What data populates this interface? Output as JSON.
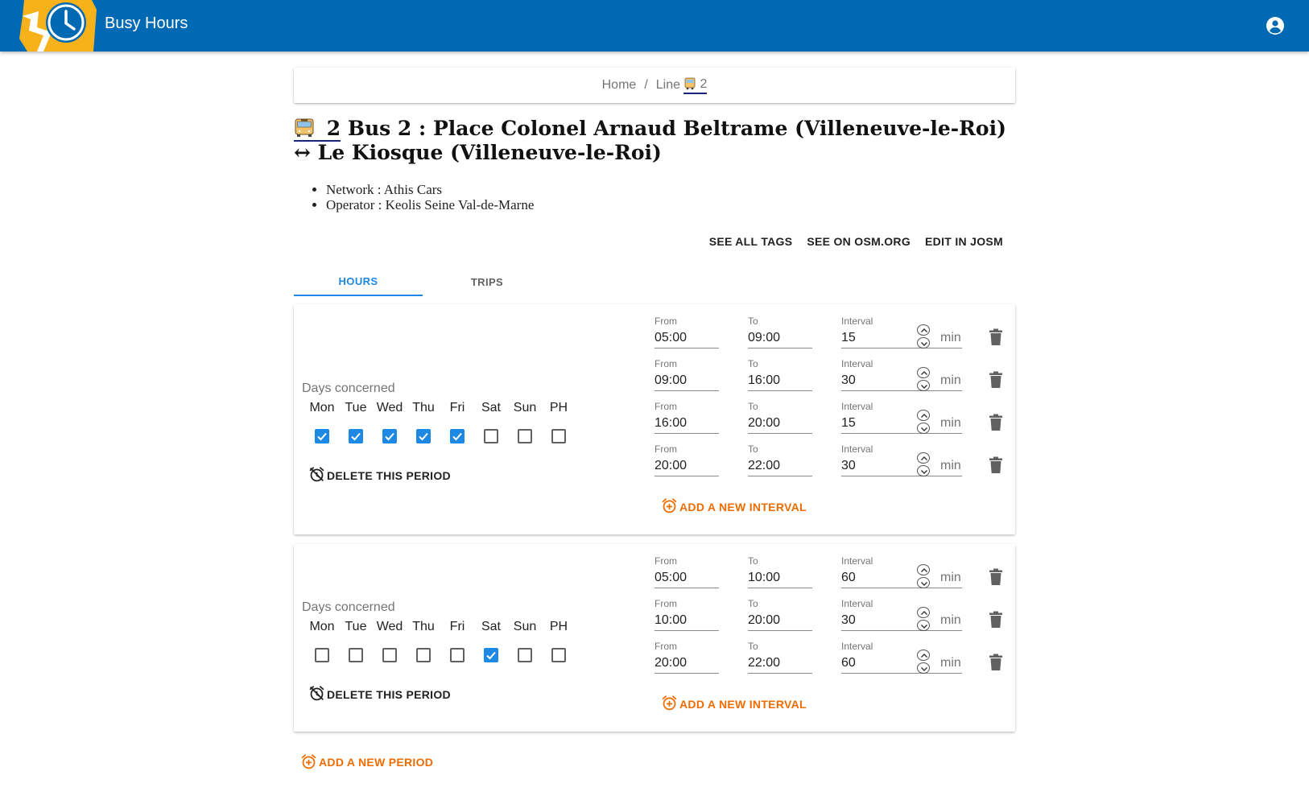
{
  "app": {
    "title": "Busy Hours",
    "account_icon": "account-circle-icon"
  },
  "breadcrumb": {
    "home": "Home",
    "separator": "/",
    "line_prefix": "Line",
    "line_ref": "2"
  },
  "line": {
    "ref": "2",
    "title_rest": " Bus 2 : Place Colonel Arnaud Beltrame (Villeneuve-le-Roi) ↔ Le Kiosque (Villeneuve-le-Roi)",
    "network": "Network : Athis Cars",
    "operator": "Operator : Keolis Seine Val-de-Marne"
  },
  "actions": {
    "see_all_tags": "See all tags",
    "see_on_osm": "See on OSM.org",
    "edit_josm": "Edit in JOSM"
  },
  "tabs": {
    "hours": "Hours",
    "trips": "Trips"
  },
  "labels": {
    "days_concerned": "Days concerned",
    "from": "From",
    "to": "To",
    "interval": "Interval",
    "unit": "min",
    "delete_period": "Delete this period",
    "add_interval": "Add a new interval",
    "add_period": "Add a new period"
  },
  "days": [
    "Mon",
    "Tue",
    "Wed",
    "Thu",
    "Fri",
    "Sat",
    "Sun",
    "PH"
  ],
  "periods": [
    {
      "checked": [
        true,
        true,
        true,
        true,
        true,
        false,
        false,
        false
      ],
      "intervals": [
        {
          "from": "05:00",
          "to": "09:00",
          "interval": "15"
        },
        {
          "from": "09:00",
          "to": "16:00",
          "interval": "30"
        },
        {
          "from": "16:00",
          "to": "20:00",
          "interval": "15"
        },
        {
          "from": "20:00",
          "to": "22:00",
          "interval": "30"
        }
      ]
    },
    {
      "checked": [
        false,
        false,
        false,
        false,
        false,
        true,
        false,
        false
      ],
      "intervals": [
        {
          "from": "05:00",
          "to": "10:00",
          "interval": "60"
        },
        {
          "from": "10:00",
          "to": "20:00",
          "interval": "30"
        },
        {
          "from": "20:00",
          "to": "22:00",
          "interval": "60"
        }
      ]
    }
  ],
  "colors": {
    "appbar": "#0069b4",
    "accent": "#1e88e5",
    "orange": "#ef6c00",
    "logo_yellow": "#f7b21b"
  }
}
